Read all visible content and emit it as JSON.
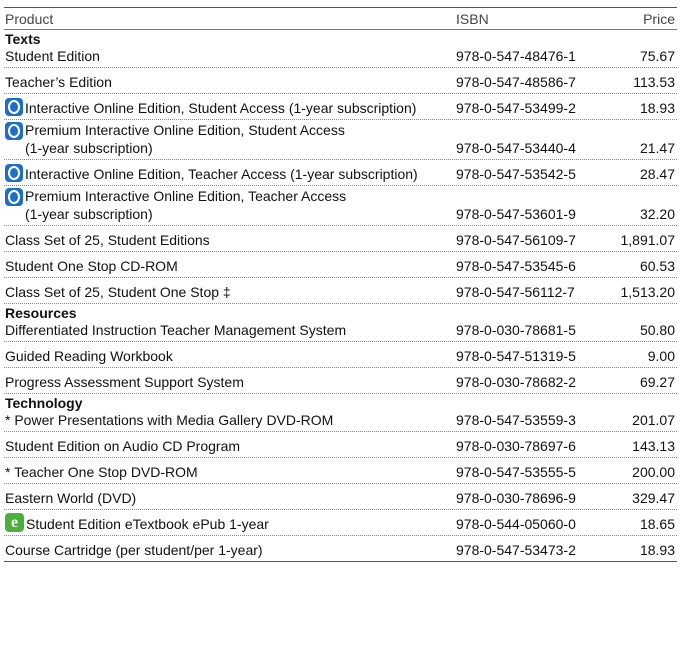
{
  "header": {
    "product": "Product",
    "isbn": "ISBN",
    "price": "Price"
  },
  "sections": [
    {
      "title": "Texts",
      "rows": [
        {
          "product": "Student Edition",
          "isbn": "978-0-547-48476-1",
          "price": "75.67"
        },
        {
          "product": "Teacher’s Edition",
          "isbn": "978-0-547-48586-7",
          "price": "113.53"
        },
        {
          "icon": "online-o-icon",
          "product": "Interactive Online Edition, Student Access (1-year subscription)",
          "isbn": "978-0-547-53499-2",
          "price": "18.93"
        },
        {
          "icon": "online-o-icon",
          "product_line1": "Premium Interactive Online Edition, Student Access",
          "product_line2": "(1-year subscription)",
          "isbn": "978-0-547-53440-4",
          "price": "21.47"
        },
        {
          "icon": "online-o-icon",
          "product": "Interactive Online Edition, Teacher Access (1-year subscription)",
          "isbn": "978-0-547-53542-5",
          "price": "28.47"
        },
        {
          "icon": "online-o-icon",
          "product_line1": "Premium Interactive Online Edition, Teacher Access",
          "product_line2": "(1-year subscription)",
          "isbn": "978-0-547-53601-9",
          "price": "32.20"
        },
        {
          "product": "Class Set of 25, Student Editions",
          "isbn": "978-0-547-56109-7",
          "price": "1,891.07"
        },
        {
          "product": "Student One Stop CD-ROM",
          "isbn": "978-0-547-53545-6",
          "price": "60.53"
        },
        {
          "product": "Class Set of 25, Student One Stop ‡",
          "isbn": "978-0-547-56112-7",
          "price": "1,513.20"
        }
      ]
    },
    {
      "title": "Resources",
      "rows": [
        {
          "product": "Differentiated Instruction Teacher Management System",
          "isbn": "978-0-030-78681-5",
          "price": "50.80"
        },
        {
          "product": "Guided Reading Workbook",
          "isbn": "978-0-547-51319-5",
          "price": "9.00"
        },
        {
          "product": "Progress Assessment Support System",
          "isbn": "978-0-030-78682-2",
          "price": "69.27"
        }
      ]
    },
    {
      "title": "Technology",
      "rows": [
        {
          "product": "* Power Presentations with Media Gallery DVD-ROM",
          "isbn": "978-0-547-53559-3",
          "price": "201.07"
        },
        {
          "product": "Student Edition on Audio CD Program",
          "isbn": "978-0-030-78697-6",
          "price": "143.13"
        },
        {
          "product": "* Teacher One Stop DVD-ROM",
          "isbn": "978-0-547-53555-5",
          "price": "200.00"
        },
        {
          "product": "Eastern World (DVD)",
          "isbn": "978-0-030-78696-9",
          "price": "329.47"
        },
        {
          "icon": "etextbook-e-icon",
          "product": "Student Edition eTextbook ePub 1-year",
          "isbn": "978-0-544-05060-0",
          "price": "18.65"
        },
        {
          "product": "Course Cartridge (per student/per 1-year)",
          "isbn": "978-0-547-53473-2",
          "price": "18.93"
        }
      ]
    }
  ]
}
